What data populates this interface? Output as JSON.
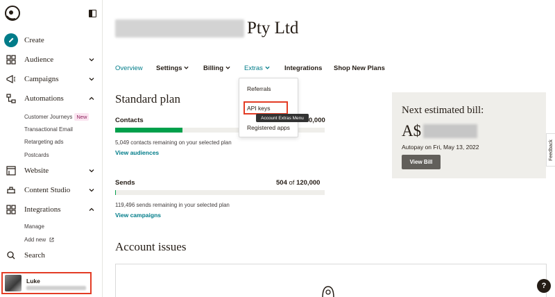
{
  "sidebar": {
    "create": "Create",
    "audience": "Audience",
    "campaigns": "Campaigns",
    "automations": "Automations",
    "automations_sub": [
      "Customer Journeys",
      "Transactional Email",
      "Retargeting ads",
      "Postcards"
    ],
    "new_badge": "New",
    "website": "Website",
    "content_studio": "Content Studio",
    "integrations": "Integrations",
    "integrations_sub": [
      "Manage",
      "Add new"
    ],
    "search": "Search",
    "user_name": "Luke"
  },
  "header": {
    "company_suffix": "Pty Ltd"
  },
  "tabs": [
    "Overview",
    "Settings",
    "Billing",
    "Extras",
    "Integrations",
    "Shop New Plans"
  ],
  "extras_menu": {
    "items": [
      "Referrals",
      "API keys",
      "Registered apps"
    ],
    "tooltip": "Account Extras Menu"
  },
  "plan": {
    "title": "Standard plan",
    "contacts_label": "Contacts",
    "contacts_value_end": "0,000",
    "contacts_progress": 0.32,
    "contacts_remaining": "5,049 contacts remaining on your selected plan",
    "view_audiences": "View audiences",
    "sends_label": "Sends",
    "sends_used": "504",
    "sends_of": "of",
    "sends_total": "120,000",
    "sends_progress": 0.004,
    "sends_remaining": "119,496 sends remaining in your selected plan",
    "view_campaigns": "View campaigns"
  },
  "bill": {
    "title": "Next estimated bill:",
    "currency": "A$",
    "autopay": "Autopay on Fri, May 13, 2022",
    "button": "View Bill"
  },
  "issues": {
    "title": "Account issues"
  },
  "feedback": "Feedback",
  "help": "?"
}
